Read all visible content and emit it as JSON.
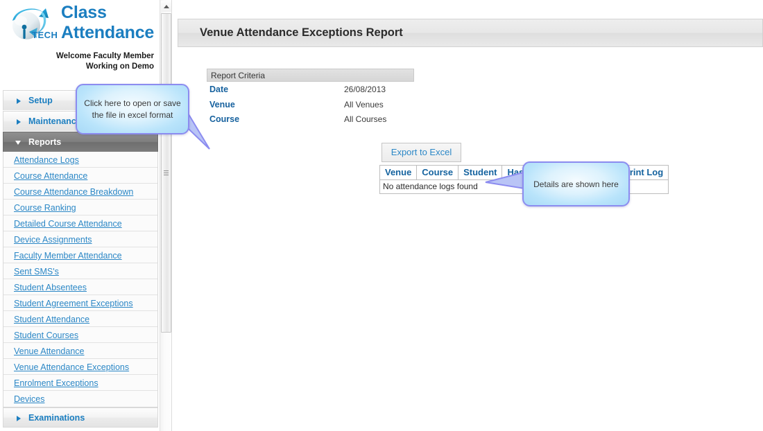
{
  "brand": {
    "logo_icon": "iptech-globe-logo",
    "title_line1": "Class",
    "title_line2": "Attendance",
    "welcome_line1": "Welcome Faculty Member",
    "welcome_line2": "Working on Demo",
    "brand_color": "#1b7ec0"
  },
  "sidebar": {
    "sections": [
      {
        "label": "Setup",
        "expanded": false,
        "icon": "triangle-right-icon"
      },
      {
        "label": "Maintenance",
        "expanded": false,
        "icon": "triangle-right-icon"
      },
      {
        "label": "Reports",
        "expanded": true,
        "icon": "triangle-down-icon"
      },
      {
        "label": "Examinations",
        "expanded": false,
        "icon": "triangle-right-icon"
      }
    ],
    "report_links": [
      "Attendance Logs",
      "Course Attendance",
      "Course Attendance Breakdown",
      "Course Ranking",
      "Detailed Course Attendance",
      "Device Assignments",
      "Faculty Member Attendance",
      "Sent SMS's",
      "Student Absentees",
      "Student Agreement Exceptions",
      "Student Attendance",
      "Student Courses",
      "Venue Attendance",
      "Venue Attendance Exceptions",
      "Enrolment Exceptions",
      "Devices"
    ],
    "link_color": "#2b87c6"
  },
  "scrollbar": {
    "up_arrow_icon": "scroll-up-arrow-icon",
    "grip_icon": "scrollbar-grip-icon"
  },
  "header": {
    "title": "Venue Attendance Exceptions Report"
  },
  "criteria": {
    "heading": "Report Criteria",
    "rows": [
      {
        "label": "Date",
        "value": "26/08/2013"
      },
      {
        "label": "Venue",
        "value": "All Venues"
      },
      {
        "label": "Course",
        "value": "All Courses"
      }
    ]
  },
  "actions": {
    "export_label": "Export to Excel"
  },
  "results": {
    "columns": [
      "Venue",
      "Course",
      "Student",
      "Has Attendance Log",
      "Has Print Log"
    ],
    "empty_message": "No attendance logs found",
    "rows": []
  },
  "callouts": [
    {
      "id": "excel",
      "text": "Click here to open or save the file in excel format",
      "border_color": "#8c8cf0"
    },
    {
      "id": "details",
      "text": "Details are shown here",
      "border_color": "#8c8cf0"
    }
  ]
}
